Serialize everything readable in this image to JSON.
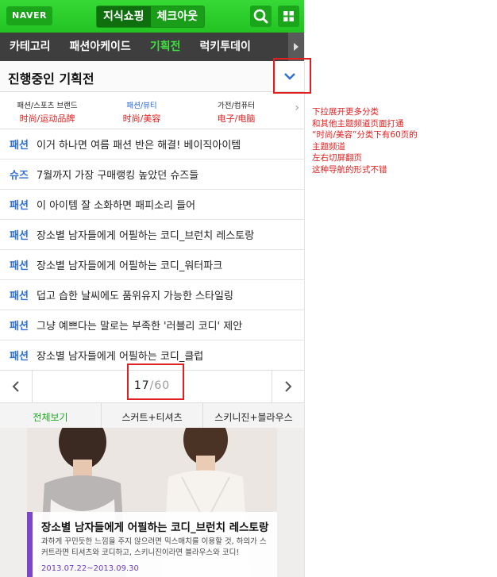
{
  "topbar": {
    "logo": "NAVER",
    "segments": [
      {
        "label": "지식쇼핑",
        "active": true
      },
      {
        "label": "체크아웃",
        "active": false
      }
    ],
    "icons": [
      "search-icon",
      "grid-icon"
    ]
  },
  "nav": {
    "items": [
      "카테고리",
      "패션아케이드",
      "기획전",
      "럭키투데이"
    ],
    "active_index": 2
  },
  "section": {
    "title": "진행중인 기획전"
  },
  "categories": [
    {
      "ko": "패션/스포츠 브랜드",
      "zh": "时尚/运动品牌",
      "active": false
    },
    {
      "ko": "패션/뷰티",
      "zh": "时尚/美容",
      "active": true
    },
    {
      "ko": "가전/컴퓨터",
      "zh": "电子/电脑",
      "active": false
    }
  ],
  "list": [
    {
      "tag": "패션",
      "text": "이거 하나면 여름 패션 반은 해결! 베이직아이템"
    },
    {
      "tag": "슈즈",
      "text": "7월까지 가장 구매랭킹 높았던 슈즈들"
    },
    {
      "tag": "패션",
      "text": "이 아이템 잘 소화하면 패피소리 들어"
    },
    {
      "tag": "패션",
      "text": "장소별 남자들에게 어필하는 코디_브런치 레스토랑"
    },
    {
      "tag": "패션",
      "text": "장소별 남자들에게 어필하는 코디_워터파크"
    },
    {
      "tag": "패션",
      "text": "덥고 습한 날씨에도 품위유지 가능한 스타일링"
    },
    {
      "tag": "패션",
      "text": "그냥 예쁘다는 말로는 부족한 '러블리 코디' 제안"
    },
    {
      "tag": "패션",
      "text": "장소별 남자들에게 어필하는 코디_클럽"
    }
  ],
  "pager": {
    "current": "17",
    "total": "/60"
  },
  "subtabs": [
    "전체보기",
    "스커트+티셔츠",
    "스키니진+블라우스"
  ],
  "banner": {
    "title": "장소별 남자들에게 어필하는 코디_브런치 레스토랑",
    "desc": "과하게 꾸민듯한 느낌을 주지 않으려면 믹스매치를 이용할 것, 하의가 스커트라면 티셔츠와 코디하고, 스키니진이라면 블라우스와 코디!",
    "date": "2013.07.22~2013.09.30"
  },
  "annotation": {
    "lines": [
      "下拉展开更多分类",
      "和其他主题频道页面打通",
      "“时尚/美容”分类下有60页的",
      "主题频道",
      "左右切屏翻页",
      "这种导航的形式不错"
    ],
    "color": "#e02020"
  },
  "colors": {
    "brand_green": "#22c322",
    "tag_blue": "#2f6fd6",
    "active_nav_green": "#3ee03e",
    "highlight_red": "#e02020"
  }
}
